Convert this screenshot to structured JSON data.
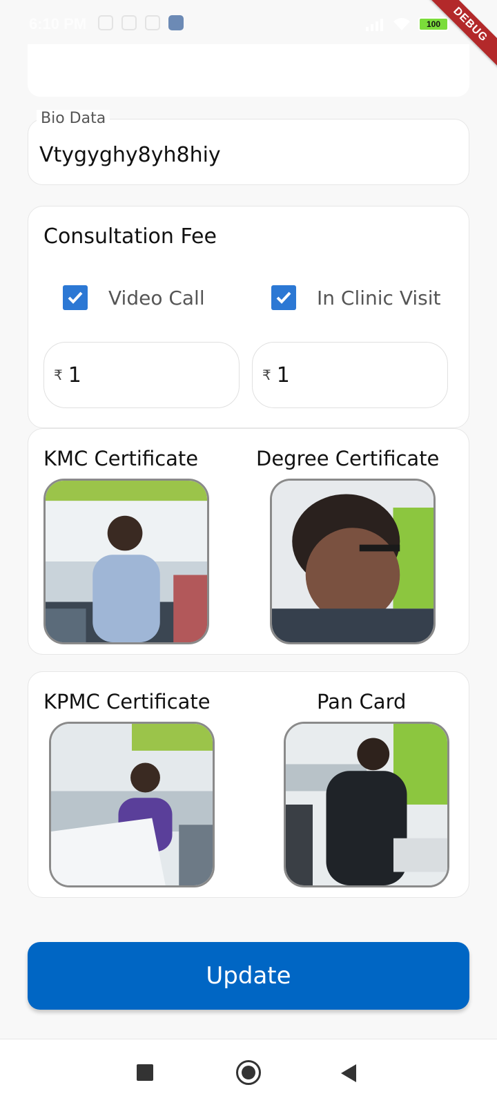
{
  "status_bar": {
    "time": "6:10 PM",
    "battery": "100"
  },
  "debug_banner": "DEBUG",
  "bio": {
    "label": "Bio Data",
    "value": "Vtygyghy8yh8hiy"
  },
  "consultation": {
    "title": "Consultation Fee",
    "options": [
      {
        "label": "Video Call",
        "checked": true
      },
      {
        "label": "In Clinic Visit",
        "checked": true
      }
    ],
    "currency_symbol": "₹",
    "fees": [
      "1",
      "1"
    ]
  },
  "certificates": [
    {
      "title": "KMC Certificate"
    },
    {
      "title": "Degree Certificate"
    },
    {
      "title": "KPMC Certificate"
    },
    {
      "title": "Pan Card"
    }
  ],
  "update_button": "Update",
  "colors": {
    "primary": "#0066c4",
    "checkbox": "#2c78d4",
    "debug": "#b3292a"
  }
}
